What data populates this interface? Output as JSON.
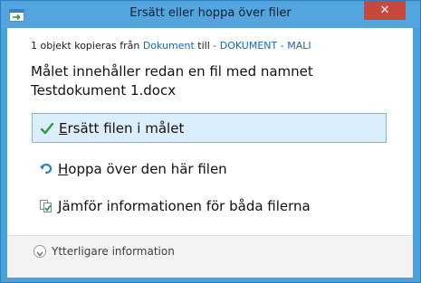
{
  "window": {
    "title": "Ersätt eller hoppa över filer",
    "close_glyph": "✕"
  },
  "summary": {
    "prefix": "1 objekt kopieras från ",
    "source": "Dokument",
    "middle": " till ",
    "destination": "- DOKUMENT - MALI"
  },
  "message": "Målet innehåller redan en fil med namnet Testdokument 1.docx",
  "options": [
    {
      "accel": "E",
      "rest": "rsätt filen i målet",
      "icon": "checkmark-icon",
      "selected": true
    },
    {
      "accel": "H",
      "rest": "oppa över den här filen",
      "icon": "skip-arrow-icon",
      "selected": false
    },
    {
      "accel": "J",
      "rest": "ämför informationen för båda filerna",
      "icon": "compare-files-icon",
      "selected": false
    }
  ],
  "footer": {
    "more_info": "Ytterligare information",
    "icon": "chevron-down-icon"
  },
  "colors": {
    "titlebar": "#52a5de",
    "close_button": "#c7483d",
    "link": "#1a66b8",
    "selection_bg": "#dbeefc",
    "selection_border": "#7cb4e4"
  }
}
